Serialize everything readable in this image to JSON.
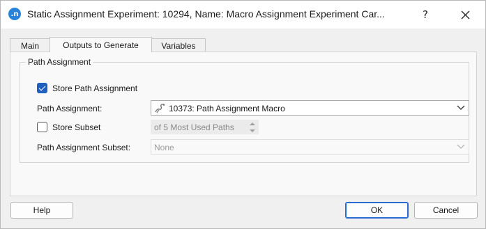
{
  "window": {
    "app_icon_text": ".n",
    "title": "Static Assignment Experiment: 10294, Name: Macro Assignment Experiment Car...",
    "help_glyph": "?",
    "close_glyph": "✕"
  },
  "tabs": [
    {
      "label": "Main",
      "active": false
    },
    {
      "label": "Outputs to Generate",
      "active": true
    },
    {
      "label": "Variables",
      "active": false
    }
  ],
  "path_assignment_group": {
    "legend": "Path Assignment",
    "store_path_assignment": {
      "label": "Store Path Assignment",
      "checked": true
    },
    "path_assignment": {
      "label": "Path Assignment:",
      "value": "10373: Path Assignment Macro",
      "icon": "macro-icon"
    },
    "store_subset": {
      "label": "Store Subset",
      "checked": false
    },
    "subset_size": {
      "value": "of 5 Most Used Paths",
      "enabled": false
    },
    "path_assignment_subset": {
      "label": "Path Assignment Subset:",
      "value": "None",
      "enabled": false
    }
  },
  "buttons": {
    "help": "Help",
    "ok": "OK",
    "cancel": "Cancel"
  },
  "colors": {
    "accent": "#1f5fbf",
    "app_icon": "#2b82d9"
  }
}
